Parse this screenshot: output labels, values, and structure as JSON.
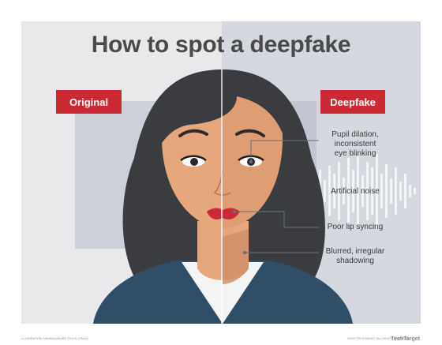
{
  "title": "How to spot a deepfake",
  "tags": {
    "original": "Original",
    "deepfake": "Deepfake"
  },
  "callouts": {
    "pupil": [
      "Pupil dilation,",
      "inconsistent",
      "eye blinking"
    ],
    "noise": "Artificial noise",
    "lip": "Poor lip syncing",
    "blur": [
      "Blurred, irregular",
      "shadowing"
    ]
  },
  "footer": {
    "left": "ILLUSTRATION: IVANRAG/ADOBE STOCK; FRAGO",
    "right": "©2022 TECHTARGET. ALL RIGHTS RESERVED.",
    "logo": "TechTarget"
  },
  "colors": {
    "accent_red": "#cc2a32",
    "hair": "#3a3c40",
    "skin": "#e5a77b",
    "skin_shadow": "#cf8e68",
    "jacket": "#2f4f68"
  }
}
